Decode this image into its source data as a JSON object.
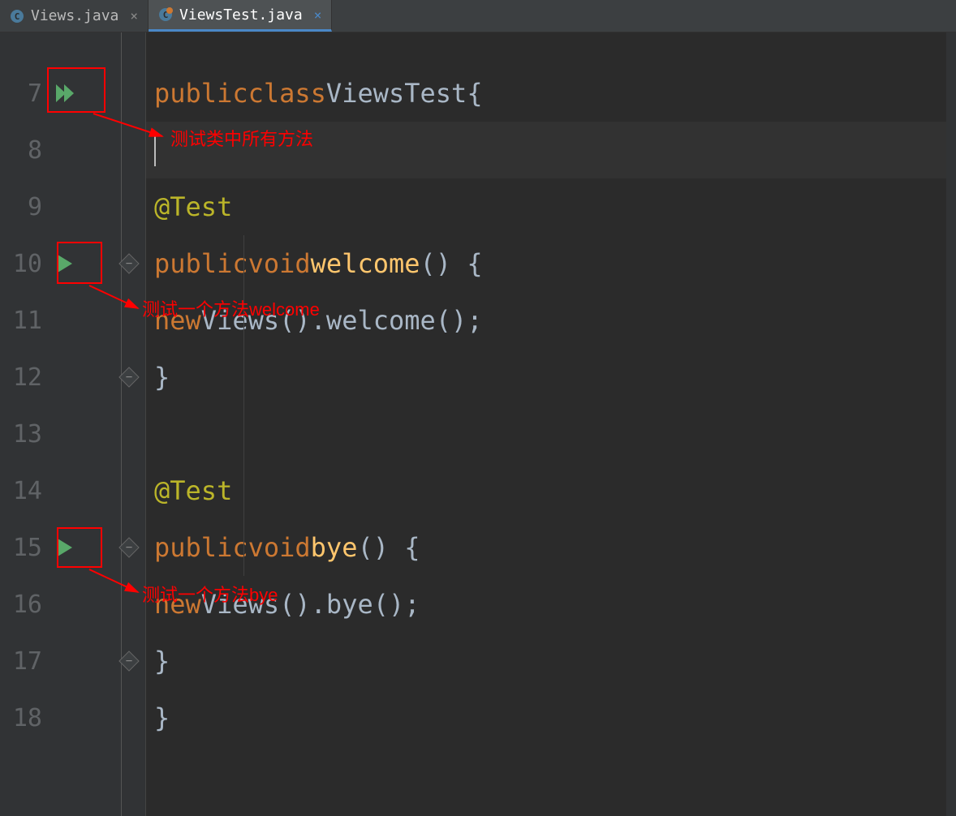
{
  "tabs": [
    {
      "label": "Views.java",
      "active": false,
      "modified": false
    },
    {
      "label": "ViewsTest.java",
      "active": true,
      "modified": true
    }
  ],
  "lineNumbers": [
    "",
    "7",
    "8",
    "9",
    "10",
    "11",
    "12",
    "13",
    "14",
    "15",
    "16",
    "17",
    "18"
  ],
  "code": {
    "l7": {
      "kw1": "public",
      "kw2": "class",
      "cls": "ViewsTest",
      "br": "{"
    },
    "l9": {
      "ann": "@Test"
    },
    "l10": {
      "kw1": "public",
      "kw2": "void",
      "mtd": "welcome",
      "rest": "() {"
    },
    "l11": {
      "kw": "new",
      "expr": "Views().",
      "call": "welcome",
      "end": "();"
    },
    "l12": {
      "br": "}"
    },
    "l14": {
      "ann": "@Test"
    },
    "l15": {
      "kw1": "public",
      "kw2": "void",
      "mtd": "bye",
      "rest": "() {"
    },
    "l16": {
      "kw": "new",
      "expr": "Views().",
      "call": "bye",
      "end": "();"
    },
    "l17": {
      "br": "}"
    },
    "l18": {
      "br": "}"
    }
  },
  "annotations": {
    "a1": "测试类中所有方法",
    "a2": "测试一个方法welcome",
    "a3": "测试一个方法bye"
  }
}
